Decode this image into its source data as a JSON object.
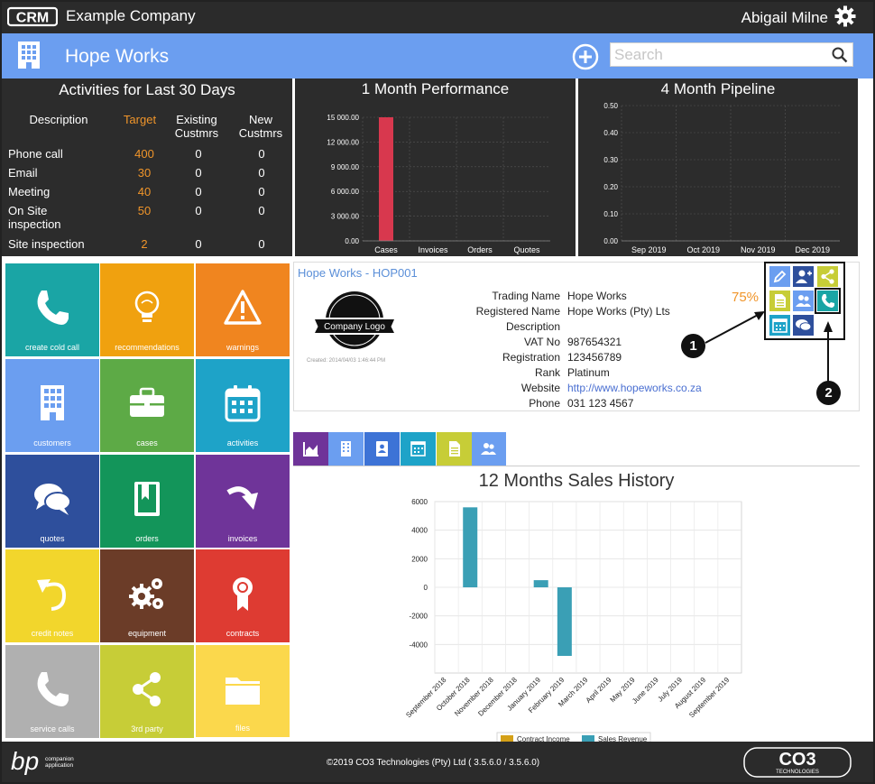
{
  "topbar": {
    "logo_text": "CRM",
    "company": "Example Company",
    "user": "Abigail Milne"
  },
  "header": {
    "title": "Hope Works",
    "search_placeholder": "Search"
  },
  "activities": {
    "title": "Activities for Last 30 Days",
    "headers": {
      "description": "Description",
      "target": "Target",
      "existing": "Existing Custmrs",
      "new": "New Custmrs"
    },
    "rows": [
      {
        "description": "Phone call",
        "target": "400",
        "existing": "0",
        "new": "0"
      },
      {
        "description": "Email",
        "target": "30",
        "existing": "0",
        "new": "0"
      },
      {
        "description": "Meeting",
        "target": "40",
        "existing": "0",
        "new": "0"
      },
      {
        "description": "On Site inspection",
        "target": "50",
        "existing": "0",
        "new": "0"
      },
      {
        "description": "Site inspection",
        "target": "2",
        "existing": "0",
        "new": "0"
      }
    ]
  },
  "chart_data": [
    {
      "type": "bar",
      "title": "1 Month Performance",
      "categories": [
        "Cases",
        "Invoices",
        "Orders",
        "Quotes"
      ],
      "values": [
        15000,
        0,
        0,
        0
      ],
      "ylim": [
        0,
        15000
      ],
      "yticks": [
        "0.00",
        "3 000.00",
        "6 000.00",
        "9 000.00",
        "12 000.00",
        "15 000.00"
      ],
      "bar_color": "#d8384e"
    },
    {
      "type": "bar",
      "title": "4 Month Pipeline",
      "categories": [
        "Sep 2019",
        "Oct 2019",
        "Nov 2019",
        "Dec 2019"
      ],
      "values": [
        0,
        0,
        0,
        0
      ],
      "ylim": [
        0,
        0.5
      ],
      "yticks": [
        "0.00",
        "0.10",
        "0.20",
        "0.30",
        "0.40",
        "0.50"
      ]
    },
    {
      "type": "bar",
      "title": "12 Months Sales History",
      "categories": [
        "September 2018",
        "October 2018",
        "November 2018",
        "December 2018",
        "January 2019",
        "February 2019",
        "March 2019",
        "April 2019",
        "May 2019",
        "June 2019",
        "July 2019",
        "August 2019",
        "September 2019"
      ],
      "series": [
        {
          "name": "Contract Income",
          "values": [
            0,
            0,
            0,
            0,
            0,
            0,
            0,
            0,
            0,
            0,
            0,
            0,
            0
          ],
          "color": "#d4a017"
        },
        {
          "name": "Sales Revenue",
          "values": [
            0,
            5600,
            0,
            0,
            500,
            -4800,
            0,
            0,
            0,
            0,
            0,
            0,
            0
          ],
          "color": "#3a9fb5"
        }
      ],
      "ylim": [
        -6000,
        6000
      ],
      "yticks": [
        "6000",
        "4000",
        "2000",
        "0",
        "-2000",
        "-4000"
      ]
    }
  ],
  "tiles": [
    {
      "label": "create cold call",
      "color": "#1aa5a5",
      "icon": "phone-icon"
    },
    {
      "label": "recommendations",
      "color": "#f0a10f",
      "icon": "lightbulb-icon"
    },
    {
      "label": "warnings",
      "color": "#f0851f",
      "icon": "warning-icon"
    },
    {
      "label": "customers",
      "color": "#6b9ef0",
      "icon": "building-icon"
    },
    {
      "label": "cases",
      "color": "#5daa46",
      "icon": "toolbox-icon"
    },
    {
      "label": "activities",
      "color": "#1ea3c8",
      "icon": "calendar-icon"
    },
    {
      "label": "quotes",
      "color": "#2e4f9c",
      "icon": "speech-bubbles-icon"
    },
    {
      "label": "orders",
      "color": "#13955a",
      "icon": "bookmark-book-icon"
    },
    {
      "label": "invoices",
      "color": "#6f3499",
      "icon": "redo-arrow-icon"
    },
    {
      "label": "credit notes",
      "color": "#f2d62c",
      "icon": "undo-arrow-icon"
    },
    {
      "label": "equipment",
      "color": "#6b3c28",
      "icon": "gears-icon"
    },
    {
      "label": "contracts",
      "color": "#de3b32",
      "icon": "ribbon-icon"
    },
    {
      "label": "service calls",
      "color": "#b0b0b0",
      "icon": "phone-icon"
    },
    {
      "label": "3rd party",
      "color": "#c7cd37",
      "icon": "share-icon"
    },
    {
      "label": "files",
      "color": "#fbd84c",
      "icon": "folder-icon"
    }
  ],
  "company": {
    "heading": "Hope Works - HOP001",
    "logo_text": "Company Logo",
    "created": "Created: 2014/04/03 1:46:44 PM",
    "percent": "75%",
    "fields": [
      {
        "key": "Trading Name",
        "value": "Hope Works"
      },
      {
        "key": "Registered Name",
        "value": "Hope Works (Pty) Lts"
      },
      {
        "key": "Description",
        "value": ""
      },
      {
        "key": "VAT No",
        "value": "987654321"
      },
      {
        "key": "Registration",
        "value": "123456789"
      },
      {
        "key": "Rank",
        "value": "Platinum"
      },
      {
        "key": "Website",
        "value": "http://www.hopeworks.co.za"
      },
      {
        "key": "Phone",
        "value": "031 123 4567"
      }
    ]
  },
  "callouts": [
    "1",
    "2"
  ],
  "footer": {
    "copyright": "©2019 CO3 Technologies (Pty) Ltd ( 3.5.6.0 / 3.5.6.0)",
    "bp_text": "bp",
    "bp_sub1": "companion",
    "bp_sub2": "application",
    "co3_text": "CO3",
    "co3_sub": "TECHNOLOGIES"
  }
}
